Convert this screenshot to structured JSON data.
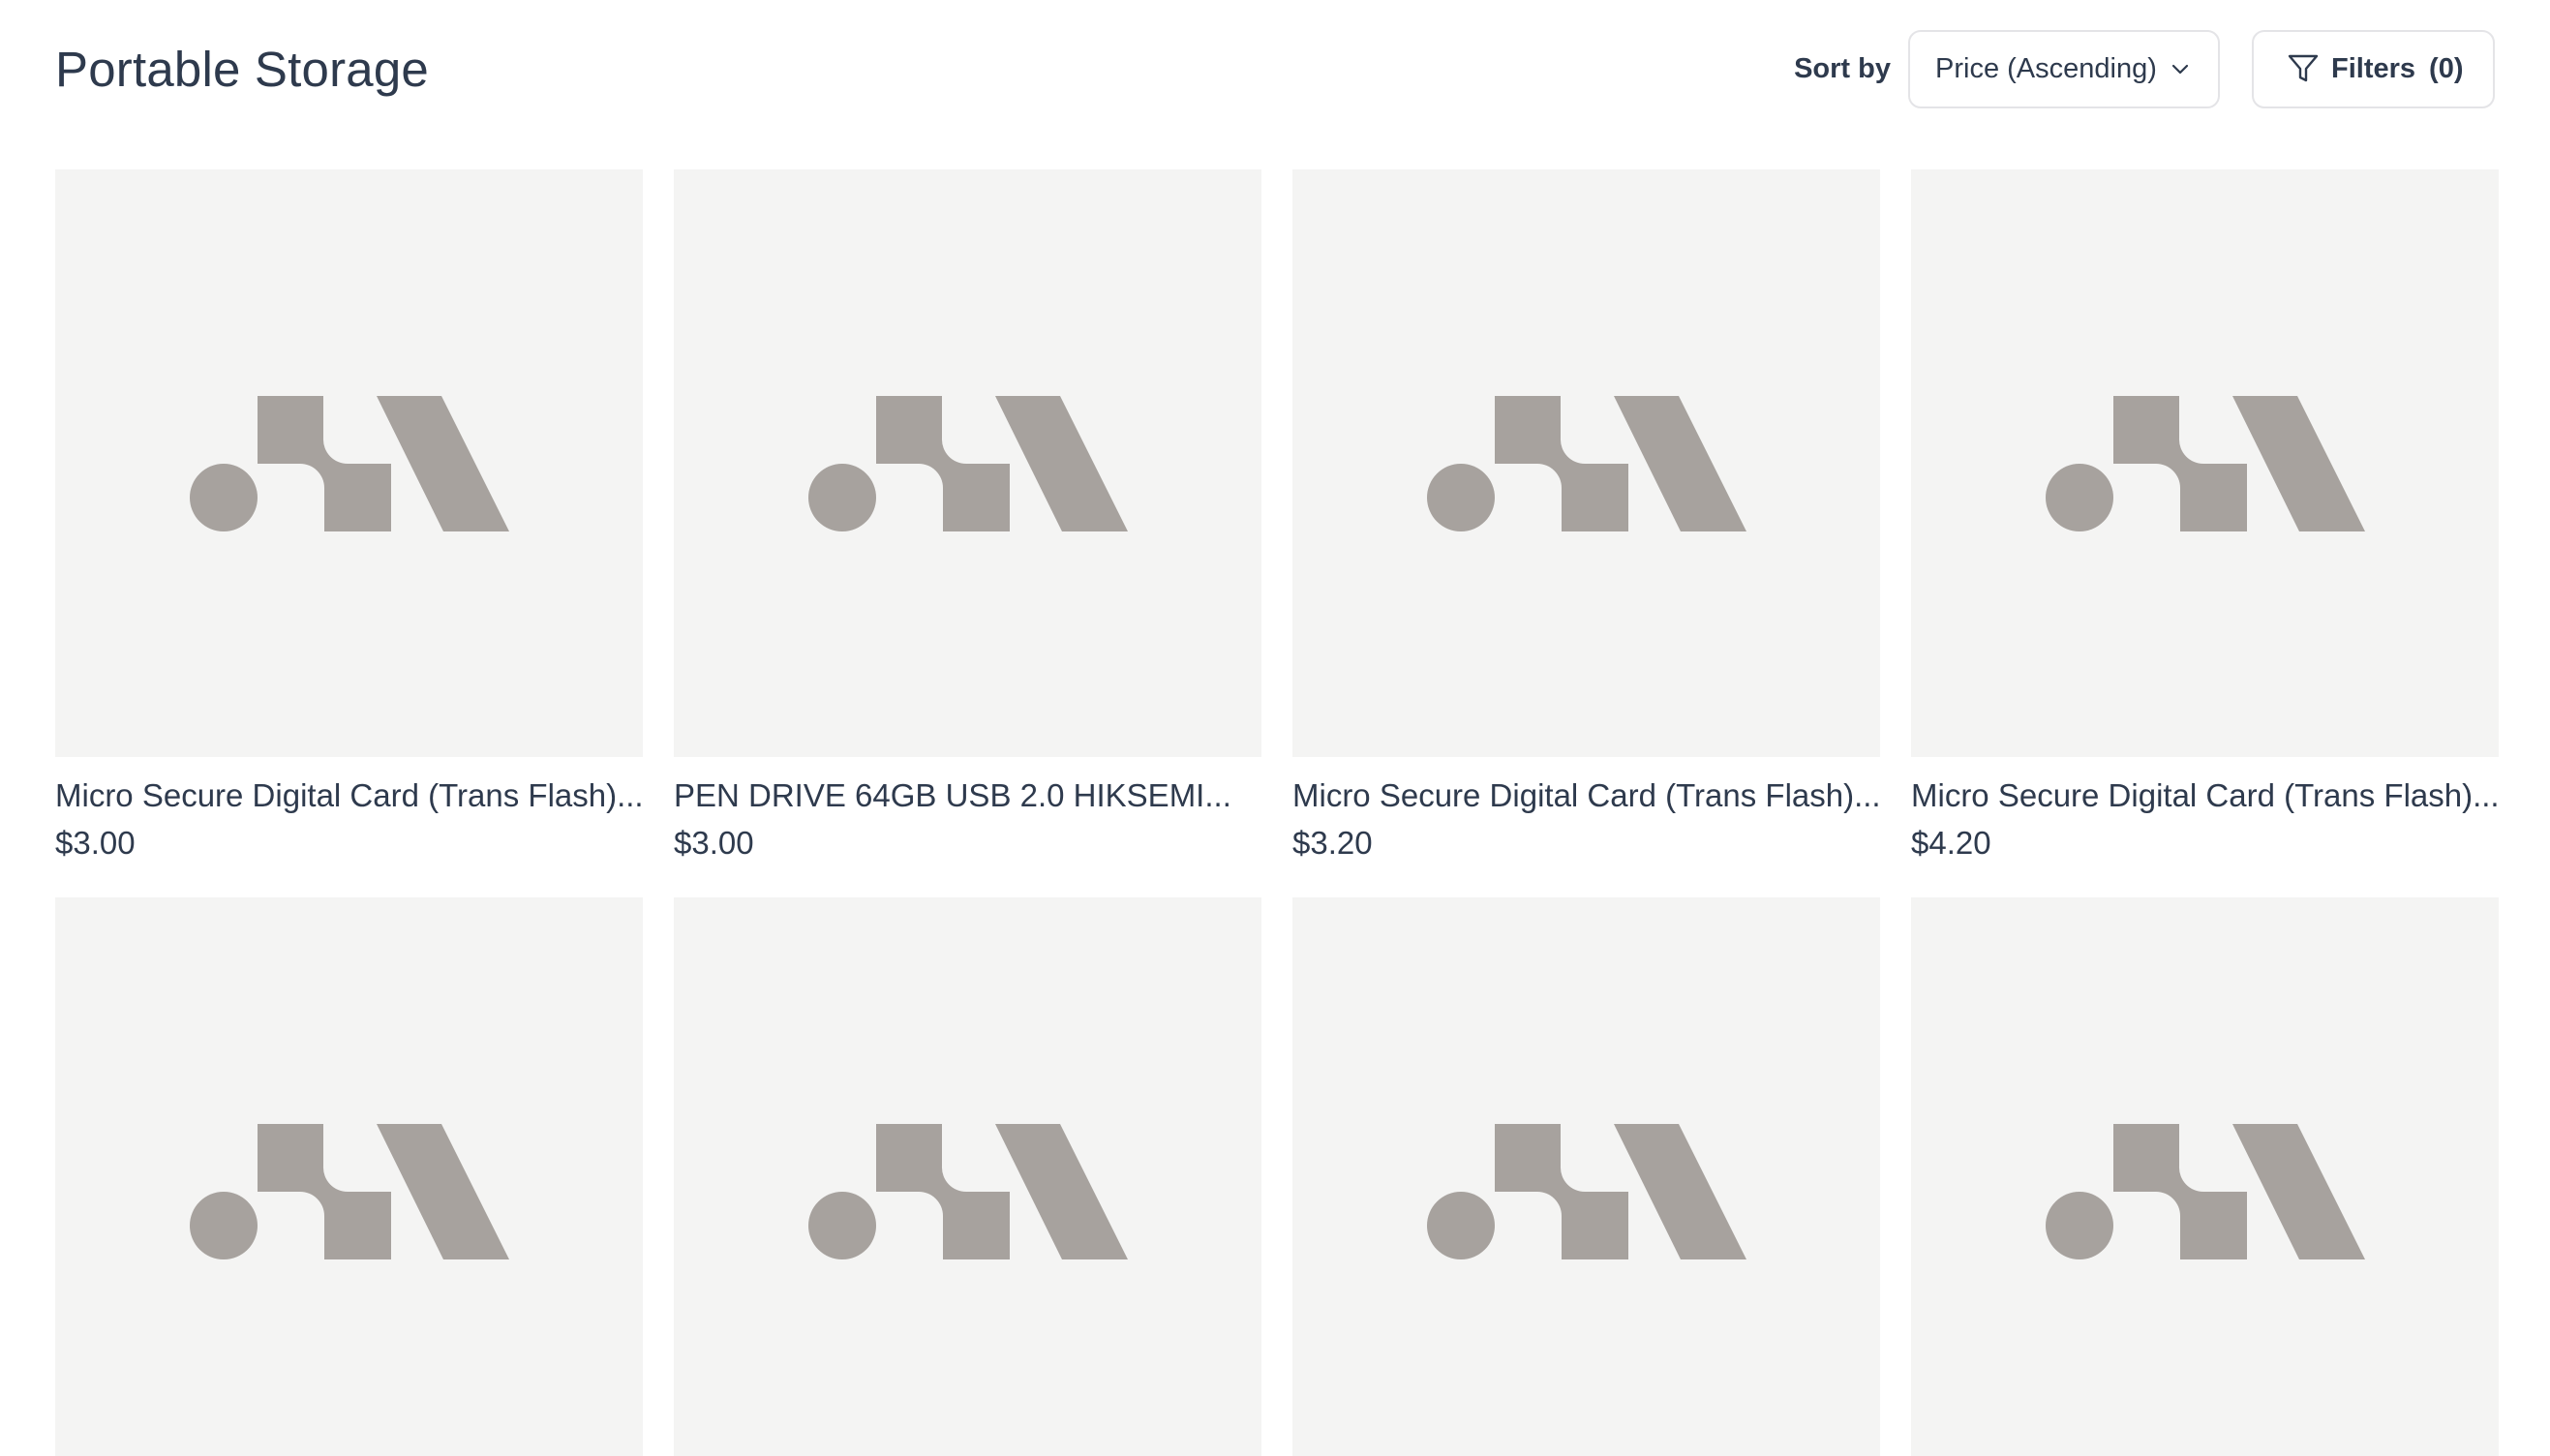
{
  "page": {
    "title": "Portable Storage"
  },
  "sort": {
    "label": "Sort by",
    "selected": "Price (Ascending)"
  },
  "filters": {
    "label": "Filters",
    "count": "(0)"
  },
  "products": [
    {
      "name": "Micro Secure Digital Card (Trans Flash)...",
      "price": "$3.00"
    },
    {
      "name": "PEN DRIVE 64GB USB 2.0 HIKSEMI...",
      "price": "$3.00"
    },
    {
      "name": "Micro Secure Digital Card (Trans Flash)...",
      "price": "$3.20"
    },
    {
      "name": "Micro Secure Digital Card (Trans Flash)...",
      "price": "$4.20"
    },
    {
      "name": "",
      "price": ""
    },
    {
      "name": "",
      "price": ""
    },
    {
      "name": "",
      "price": ""
    },
    {
      "name": "",
      "price": ""
    }
  ],
  "colors": {
    "text": "#2e3a4d",
    "image_bg": "#f4f4f3",
    "placeholder": "#a7a29e",
    "border": "#e4e4e7"
  }
}
